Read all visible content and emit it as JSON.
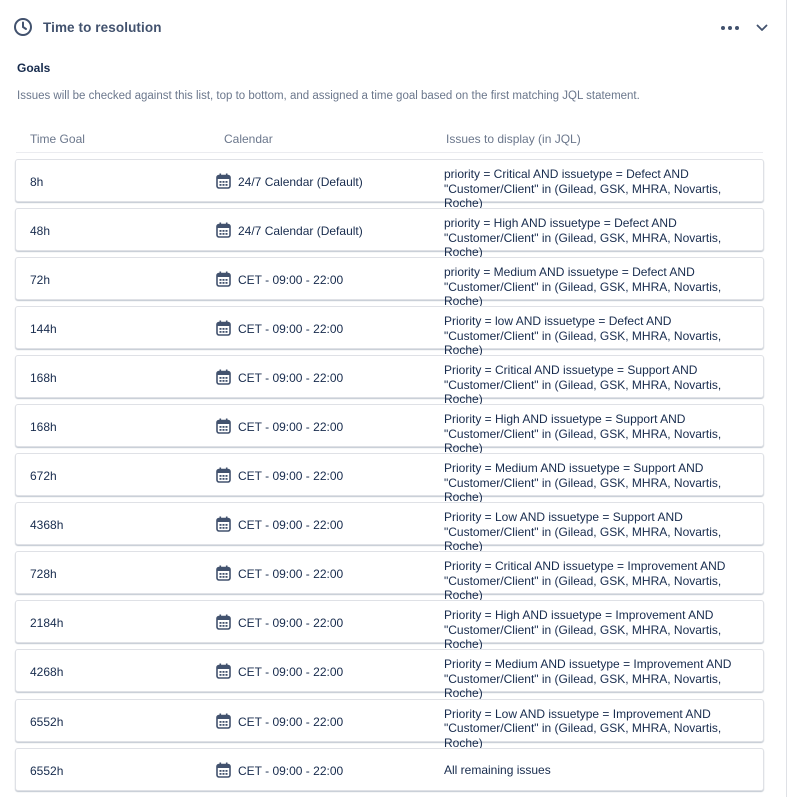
{
  "header": {
    "title": "Time to resolution",
    "icons": {
      "left": "clock-icon",
      "more": "more-horizontal-icon",
      "collapse": "chevron-down-icon"
    }
  },
  "goals": {
    "section_title": "Goals",
    "description": "Issues will be checked against this list, top to bottom, and assigned a time goal based on the first matching JQL statement.",
    "columns": [
      "Time Goal",
      "Calendar",
      "Issues to display (in JQL)"
    ],
    "rows": [
      {
        "goal": "8h",
        "calendar": "24/7 Calendar (Default)",
        "jql": [
          "priority = Critical AND issuetype = Defect AND",
          "\"Customer/Client\" in (Gilead, GSK, MHRA, Novartis, Roche)"
        ]
      },
      {
        "goal": "48h",
        "calendar": "24/7 Calendar (Default)",
        "jql": [
          "priority = High AND issuetype = Defect AND",
          "\"Customer/Client\" in (Gilead, GSK, MHRA, Novartis, Roche)"
        ]
      },
      {
        "goal": "72h",
        "calendar": "CET - 09:00 - 22:00",
        "jql": [
          "priority = Medium AND issuetype = Defect AND",
          "\"Customer/Client\" in (Gilead, GSK, MHRA, Novartis, Roche)"
        ]
      },
      {
        "goal": "144h",
        "calendar": "CET - 09:00 - 22:00",
        "jql": [
          "Priority = low AND issuetype = Defect AND",
          "\"Customer/Client\" in (Gilead, GSK, MHRA, Novartis, Roche)"
        ]
      },
      {
        "goal": "168h",
        "calendar": "CET - 09:00 - 22:00",
        "jql": [
          "Priority = Critical AND issuetype = Support AND",
          "\"Customer/Client\" in (Gilead, GSK, MHRA, Novartis, Roche)"
        ]
      },
      {
        "goal": "168h",
        "calendar": "CET - 09:00 - 22:00",
        "jql": [
          "Priority = High AND issuetype = Support AND",
          "\"Customer/Client\" in (Gilead, GSK, MHRA, Novartis, Roche)"
        ]
      },
      {
        "goal": "672h",
        "calendar": "CET - 09:00 - 22:00",
        "jql": [
          "Priority = Medium AND issuetype = Support AND",
          "\"Customer/Client\" in (Gilead, GSK, MHRA, Novartis, Roche)"
        ]
      },
      {
        "goal": "4368h",
        "calendar": "CET - 09:00 - 22:00",
        "jql": [
          "Priority = Low AND issuetype = Support AND",
          "\"Customer/Client\" in (Gilead, GSK, MHRA, Novartis, Roche)"
        ]
      },
      {
        "goal": "728h",
        "calendar": "CET - 09:00 - 22:00",
        "jql": [
          "Priority = Critical AND issuetype = Improvement AND",
          "\"Customer/Client\" in (Gilead, GSK, MHRA, Novartis, Roche)"
        ]
      },
      {
        "goal": "2184h",
        "calendar": "CET - 09:00 - 22:00",
        "jql": [
          "Priority = High AND issuetype = Improvement AND",
          "\"Customer/Client\" in (Gilead, GSK, MHRA, Novartis, Roche)"
        ]
      },
      {
        "goal": "4268h",
        "calendar": "CET - 09:00 - 22:00",
        "jql": [
          "Priority = Medium AND issuetype = Improvement AND",
          "\"Customer/Client\" in (Gilead, GSK, MHRA, Novartis, Roche)"
        ]
      },
      {
        "goal": "6552h",
        "calendar": "CET - 09:00 - 22:00",
        "jql": [
          "Priority = Low AND issuetype = Improvement AND",
          "\"Customer/Client\" in (Gilead, GSK, MHRA, Novartis, Roche)"
        ]
      },
      {
        "goal": "6552h",
        "calendar": "CET - 09:00 - 22:00",
        "jql": [
          "All remaining issues"
        ]
      }
    ]
  },
  "colors": {
    "text": "#172b4d",
    "subtle": "#6b778c",
    "icon": "#42526e",
    "border": "#dfe1e6"
  }
}
